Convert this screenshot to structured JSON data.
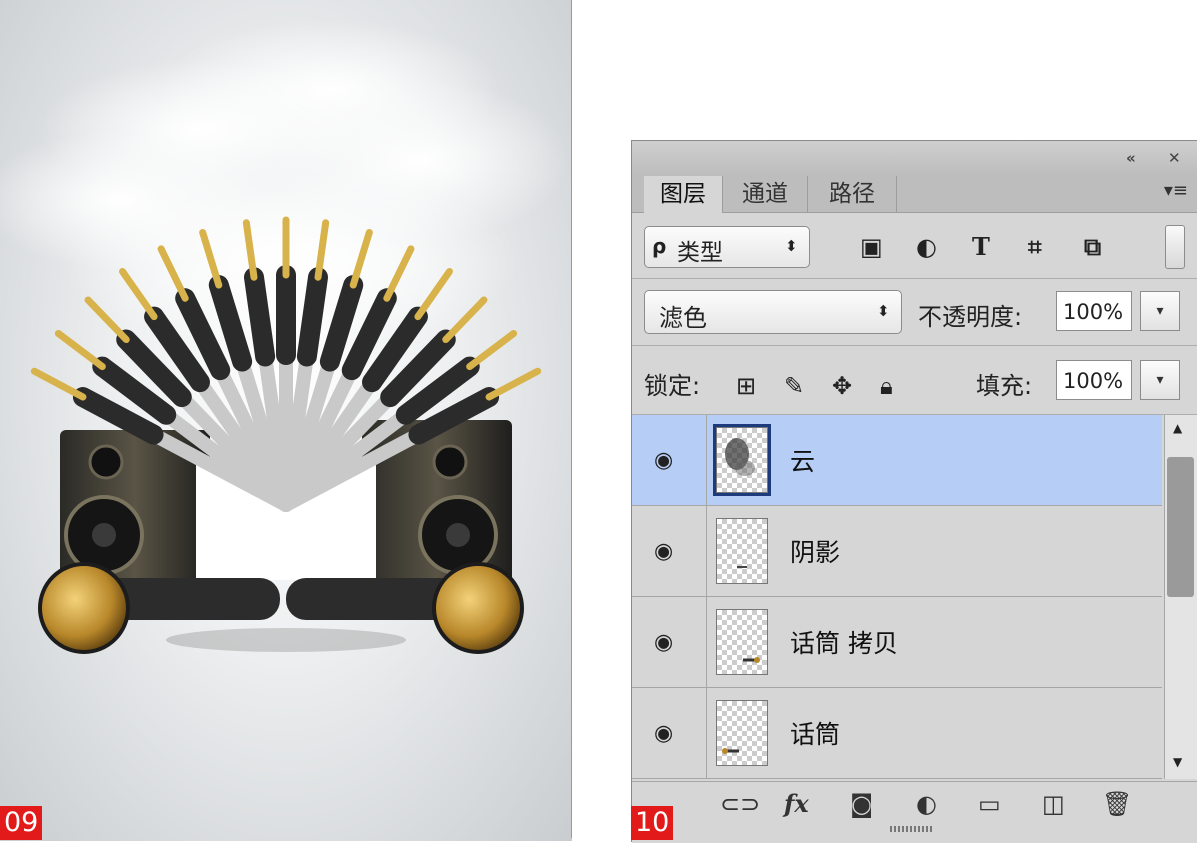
{
  "poster": {
    "step_label": "09"
  },
  "panel": {
    "step_label": "10",
    "titlebar": {
      "collapse_icon": "double-left-arrow-icon",
      "close_icon": "close-icon"
    },
    "tabs": [
      {
        "label": "图层",
        "active": true
      },
      {
        "label": "通道",
        "active": false
      },
      {
        "label": "路径",
        "active": false
      }
    ],
    "filter": {
      "kind_label": "类型",
      "icons": [
        "image-filter-icon",
        "adjustment-filter-icon",
        "type-filter-icon",
        "shape-filter-icon",
        "smart-object-filter-icon"
      ]
    },
    "blend": {
      "mode": "滤色",
      "opacity_label": "不透明度:",
      "opacity_value": "100%"
    },
    "lock": {
      "label": "锁定:",
      "fill_label": "填充:",
      "fill_value": "100%",
      "icons": [
        "lock-transparent-icon",
        "lock-brush-icon",
        "lock-move-icon",
        "lock-all-icon"
      ]
    },
    "layers": [
      {
        "name": "云",
        "selected": true
      },
      {
        "name": "阴影",
        "selected": false
      },
      {
        "name": "话筒 拷贝",
        "selected": false
      },
      {
        "name": "话筒",
        "selected": false
      }
    ],
    "bottom_icons": [
      "link-icon",
      "fx-icon",
      "mask-icon",
      "adjustment-layer-icon",
      "folder-icon",
      "new-layer-icon",
      "trash-icon"
    ],
    "colors": {
      "selected_layer": "#b6cef6",
      "panel_bg": "#d6d6d6",
      "badge": "#e31a1a"
    }
  }
}
